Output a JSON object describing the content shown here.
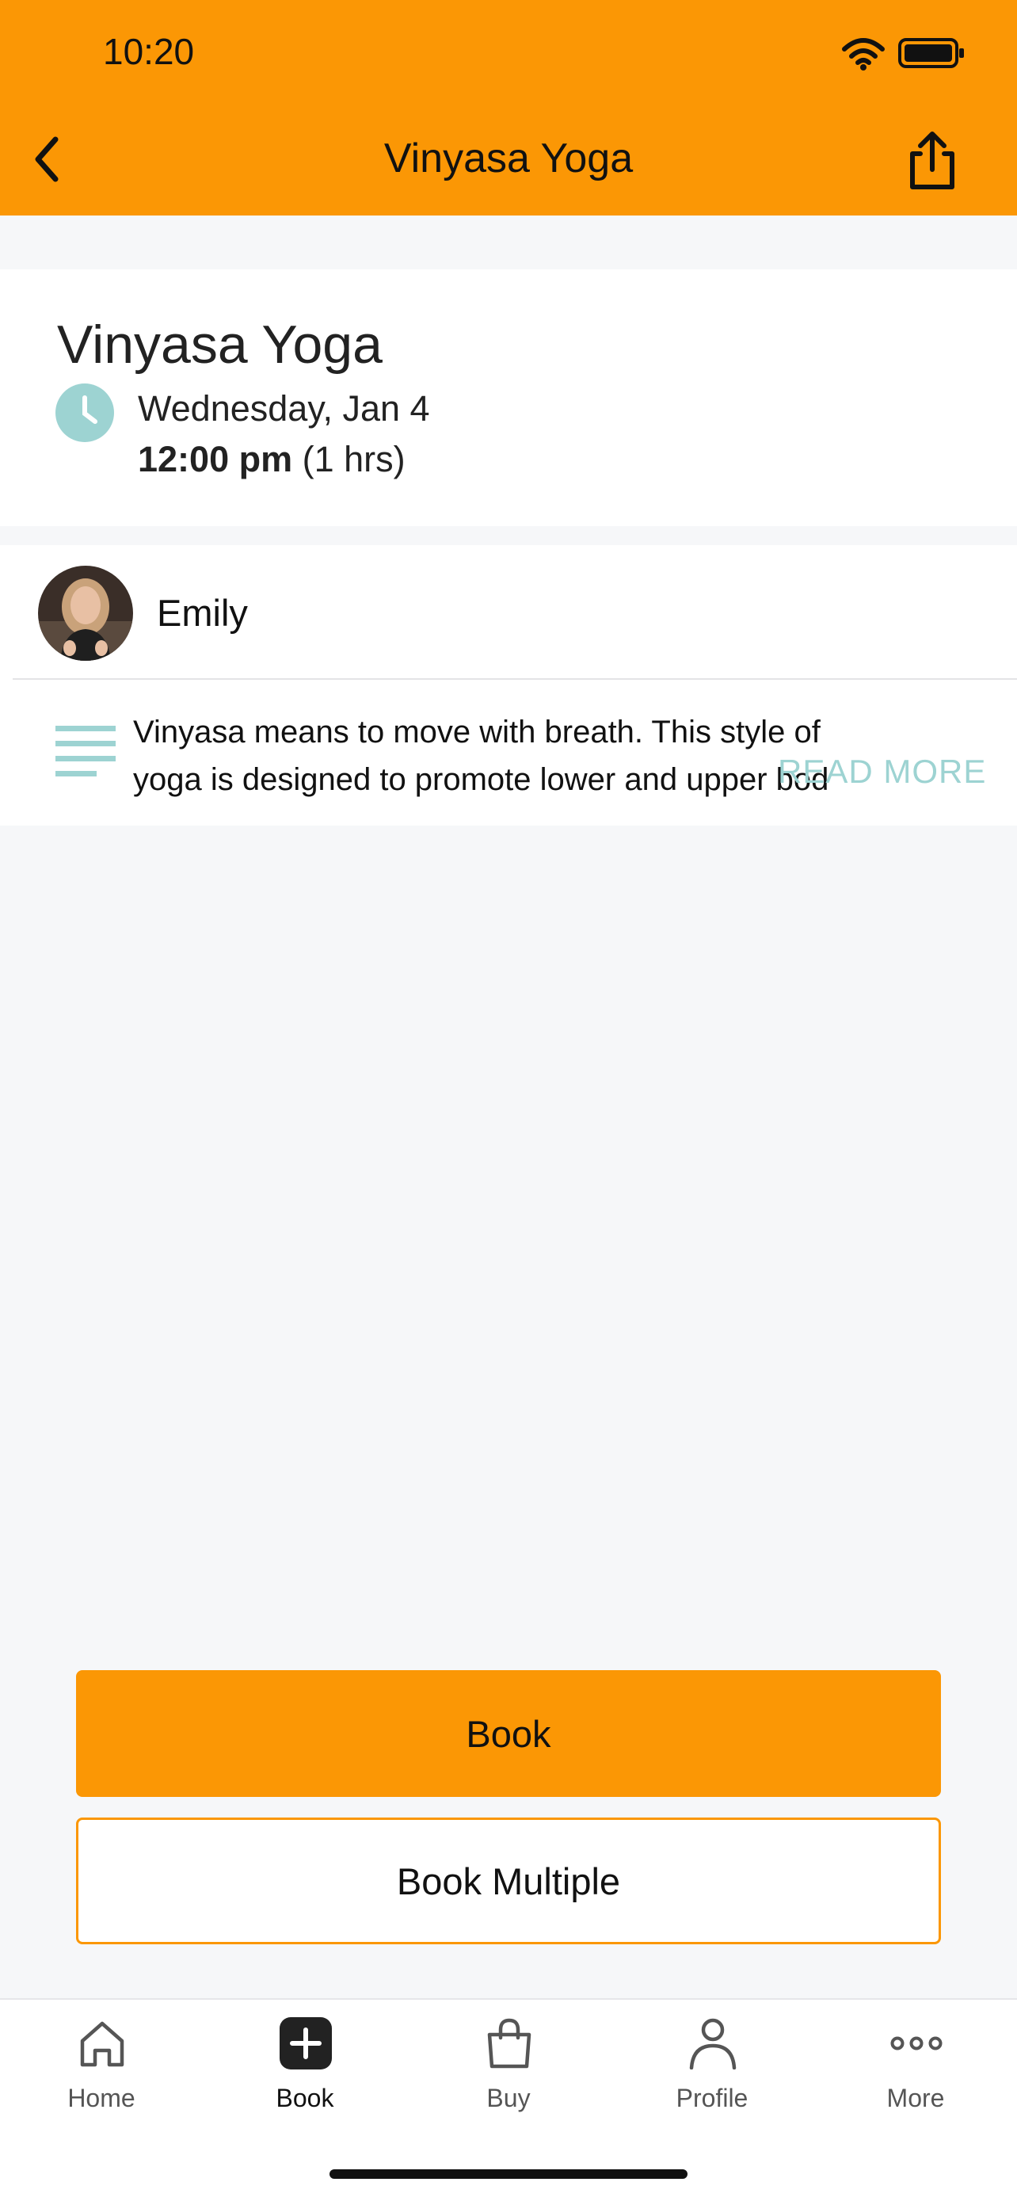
{
  "status_bar": {
    "time": "10:20"
  },
  "nav": {
    "title": "Vinyasa Yoga"
  },
  "class_info": {
    "title": "Vinyasa Yoga",
    "date": "Wednesday, Jan 4",
    "time": "12:00 pm",
    "duration": "(1 hrs)"
  },
  "instructor": {
    "name": "Emily"
  },
  "description": {
    "line1": "Vinyasa means to move with breath. This style of",
    "line2": "yoga is designed to promote lower and upper bod",
    "read_more": "READ MORE"
  },
  "actions": {
    "book": "Book",
    "book_multiple": "Book Multiple"
  },
  "tabs": [
    {
      "label": "Home",
      "icon": "home-icon"
    },
    {
      "label": "Book",
      "icon": "plus-square-icon"
    },
    {
      "label": "Buy",
      "icon": "shopping-bag-icon"
    },
    {
      "label": "Profile",
      "icon": "person-icon"
    },
    {
      "label": "More",
      "icon": "more-dots-icon"
    }
  ],
  "colors": {
    "accent": "#fb9705",
    "teal": "#9dd3d2",
    "background": "#f6f7f9"
  }
}
